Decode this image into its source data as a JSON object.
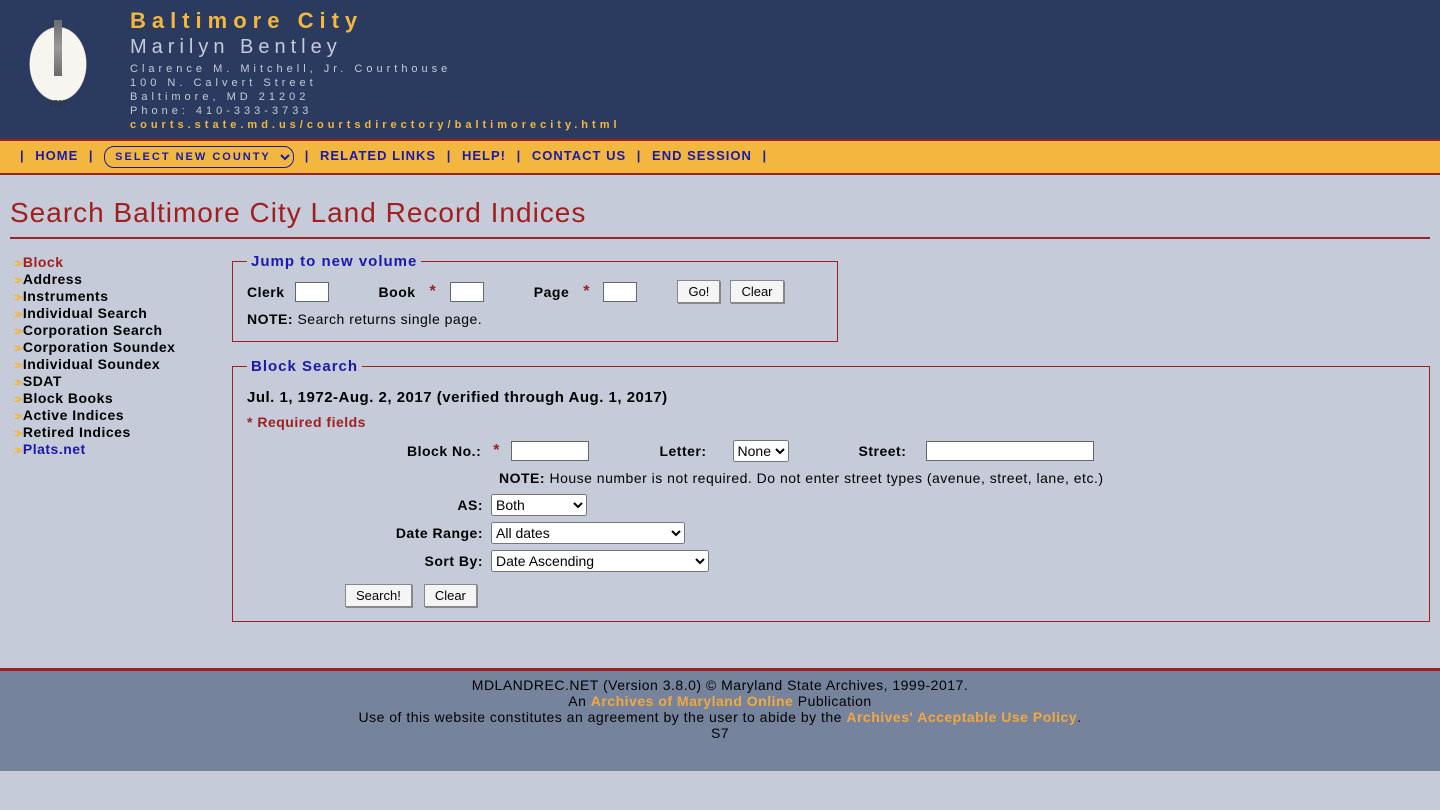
{
  "header": {
    "title": "Baltimore City",
    "name": "Marilyn Bentley",
    "line1": "Clarence M. Mitchell, Jr. Courthouse",
    "line2": "100 N. Calvert Street",
    "line3": "Baltimore, MD 21202",
    "line4": "Phone: 410-333-3733",
    "link": "courts.state.md.us/courtsdirectory/baltimorecity.html"
  },
  "nav": {
    "home": "HOME",
    "select_county": "SELECT NEW COUNTY",
    "related": "RELATED LINKS",
    "help": "HELP!",
    "contact": "CONTACT US",
    "end": "END SESSION"
  },
  "page_title": "Search Baltimore City Land Record Indices",
  "sidebar": {
    "items": [
      {
        "label": "Block",
        "state": "active"
      },
      {
        "label": "Address",
        "state": ""
      },
      {
        "label": "Instruments",
        "state": ""
      },
      {
        "label": "Individual Search",
        "state": ""
      },
      {
        "label": "Corporation Search",
        "state": ""
      },
      {
        "label": "Corporation Soundex",
        "state": ""
      },
      {
        "label": "Individual Soundex",
        "state": ""
      },
      {
        "label": "SDAT",
        "state": ""
      },
      {
        "label": "Block Books",
        "state": ""
      },
      {
        "label": "Active Indices",
        "state": ""
      },
      {
        "label": "Retired Indices",
        "state": ""
      },
      {
        "label": "Plats.net",
        "state": "external"
      }
    ]
  },
  "jump": {
    "legend": "Jump to new volume",
    "clerk_label": "Clerk",
    "book_label": "Book",
    "page_label": "Page",
    "go": "Go!",
    "clear": "Clear",
    "note_prefix": "NOTE:",
    "note_text": " Search returns single page."
  },
  "block": {
    "legend": "Block Search",
    "date_range_text": "Jul. 1, 1972-Aug. 2, 2017 (verified through Aug. 1, 2017)",
    "req_fields": "* Required fields",
    "blockno_label": "Block No.:",
    "letter_label": "Letter:",
    "letter_value": "None",
    "street_label": "Street:",
    "note_prefix": "NOTE:",
    "note_text": " House number is not required. Do not enter street types (avenue, street, lane, etc.)",
    "as_label": "AS:",
    "as_value": "Both",
    "daterange_label": "Date Range:",
    "daterange_value": "All dates",
    "sortby_label": "Sort By:",
    "sortby_value": "Date Ascending",
    "search": "Search!",
    "clear": "Clear"
  },
  "footer": {
    "l1": "MDLANDREC.NET (Version 3.8.0) © Maryland State Archives, 1999-2017.",
    "l2a": "An ",
    "l2link": "Archives of Maryland Online",
    "l2b": " Publication",
    "l3a": "Use of this website constitutes an agreement by the user to abide by the ",
    "l3link": "Archives' Acceptable Use Policy",
    "l3b": ".",
    "l4": "S7"
  }
}
